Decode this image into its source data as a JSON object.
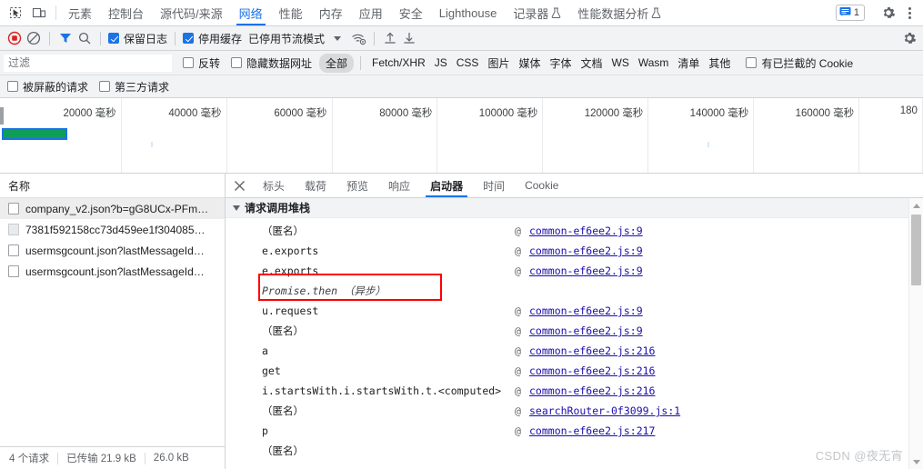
{
  "toolbar": {
    "inspect_icon": "inspect-element-icon",
    "device_icon": "device-toolbar-icon",
    "tabs": [
      {
        "label": "元素",
        "active": false,
        "flask": false
      },
      {
        "label": "控制台",
        "active": false,
        "flask": false
      },
      {
        "label": "源代码/来源",
        "active": false,
        "flask": false
      },
      {
        "label": "网络",
        "active": true,
        "flask": false
      },
      {
        "label": "性能",
        "active": false,
        "flask": false
      },
      {
        "label": "内存",
        "active": false,
        "flask": false
      },
      {
        "label": "应用",
        "active": false,
        "flask": false
      },
      {
        "label": "安全",
        "active": false,
        "flask": false
      },
      {
        "label": "Lighthouse",
        "active": false,
        "flask": false
      },
      {
        "label": "记录器",
        "active": false,
        "flask": true
      },
      {
        "label": "性能数据分析",
        "active": false,
        "flask": true
      }
    ],
    "issues_count": "1",
    "issues_icon": "issues-message-icon",
    "settings_icon": "gear-icon",
    "more_icon": "kebab-menu-icon"
  },
  "controlbar": {
    "record_icon": "record-stop-icon",
    "clear_icon": "clear-network-icon",
    "filter_icon": "filter-funnel-icon",
    "search_icon": "search-icon",
    "preserve_log": {
      "label": "保留日志",
      "checked": true
    },
    "disable_cache": {
      "label": "停用缓存",
      "checked": true
    },
    "throttling": "已停用节流模式",
    "wifi_icon": "network-conditions-icon",
    "import_icon": "import-har-icon",
    "export_icon": "export-har-icon",
    "settings_icon": "network-settings-gear-icon"
  },
  "filterbar": {
    "filter_placeholder": "过滤",
    "filter_value": "",
    "invert": {
      "label": "反转",
      "checked": false
    },
    "hide_data_urls": {
      "label": "隐藏数据网址",
      "checked": false
    },
    "types": [
      {
        "label": "全部",
        "selected": true
      },
      {
        "label": "Fetch/XHR",
        "selected": false
      },
      {
        "label": "JS",
        "selected": false
      },
      {
        "label": "CSS",
        "selected": false
      },
      {
        "label": "图片",
        "selected": false
      },
      {
        "label": "媒体",
        "selected": false
      },
      {
        "label": "字体",
        "selected": false
      },
      {
        "label": "文档",
        "selected": false
      },
      {
        "label": "WS",
        "selected": false
      },
      {
        "label": "Wasm",
        "selected": false
      },
      {
        "label": "清单",
        "selected": false
      },
      {
        "label": "其他",
        "selected": false
      }
    ],
    "blocked_cookies": {
      "label": "有已拦截的 Cookie",
      "checked": false
    },
    "blocked_requests": {
      "label": "被屏蔽的请求",
      "checked": false
    },
    "third_party": {
      "label": "第三方请求",
      "checked": false
    }
  },
  "overview": {
    "ticks": [
      "20000 毫秒",
      "40000 毫秒",
      "60000 毫秒",
      "80000 毫秒",
      "100000 毫秒",
      "120000 毫秒",
      "140000 毫秒",
      "160000 毫秒",
      "180"
    ]
  },
  "requests": {
    "column_name": "名称",
    "rows": [
      {
        "name": "company_v2.json?b=gG8UCx-PFm…",
        "selected": true,
        "icon": "json-file-icon"
      },
      {
        "name": "7381f592158cc73d459ee1f304085…",
        "selected": false,
        "icon": "document-file-icon"
      },
      {
        "name": "usermsgcount.json?lastMessageId…",
        "selected": false,
        "icon": "json-file-icon"
      },
      {
        "name": "usermsgcount.json?lastMessageId…",
        "selected": false,
        "icon": "json-file-icon"
      }
    ],
    "footer": {
      "count": "4 个请求",
      "transferred": "已传输 21.9 kB",
      "resources": "26.0 kB"
    }
  },
  "detail": {
    "close_icon": "close-icon",
    "tabs": [
      {
        "label": "标头",
        "active": false
      },
      {
        "label": "载荷",
        "active": false
      },
      {
        "label": "预览",
        "active": false
      },
      {
        "label": "响应",
        "active": false
      },
      {
        "label": "启动器",
        "active": true
      },
      {
        "label": "时间",
        "active": false
      },
      {
        "label": "Cookie",
        "active": false
      }
    ],
    "stack_title": "请求调用堆栈",
    "at_symbol": "@",
    "frames": [
      {
        "fn": "（匿名）",
        "link": "common-ef6ee2.js:9",
        "async": false,
        "highlight": false
      },
      {
        "fn": "e.exports",
        "link": "common-ef6ee2.js:9",
        "async": false,
        "highlight": false
      },
      {
        "fn": "e.exports",
        "link": "common-ef6ee2.js:9",
        "async": false,
        "highlight": false
      },
      {
        "fn": "Promise.then （异步）",
        "link": "",
        "async": true,
        "highlight": true
      },
      {
        "fn": "u.request",
        "link": "common-ef6ee2.js:9",
        "async": false,
        "highlight": false
      },
      {
        "fn": "（匿名）",
        "link": "common-ef6ee2.js:9",
        "async": false,
        "highlight": false
      },
      {
        "fn": "a",
        "link": "common-ef6ee2.js:216",
        "async": false,
        "highlight": false
      },
      {
        "fn": "get",
        "link": "common-ef6ee2.js:216",
        "async": false,
        "highlight": false
      },
      {
        "fn": "i.startsWith.i.startsWith.t.<computed>",
        "link": "common-ef6ee2.js:216",
        "async": false,
        "highlight": false
      },
      {
        "fn": "（匿名）",
        "link": "searchRouter-0f3099.js:1",
        "async": false,
        "highlight": false
      },
      {
        "fn": "p",
        "link": "common-ef6ee2.js:217",
        "async": false,
        "highlight": false
      },
      {
        "fn": "（匿名）",
        "link": "",
        "async": false,
        "highlight": false
      }
    ]
  },
  "watermark": "CSDN @夜无宵",
  "colors": {
    "accent": "#1a73e8",
    "link": "#1a0dab",
    "highlight": "#ff0000",
    "record": "#e02020",
    "bar_green": "#0f9d58",
    "toolbar_bg": "#f1f3f4"
  }
}
